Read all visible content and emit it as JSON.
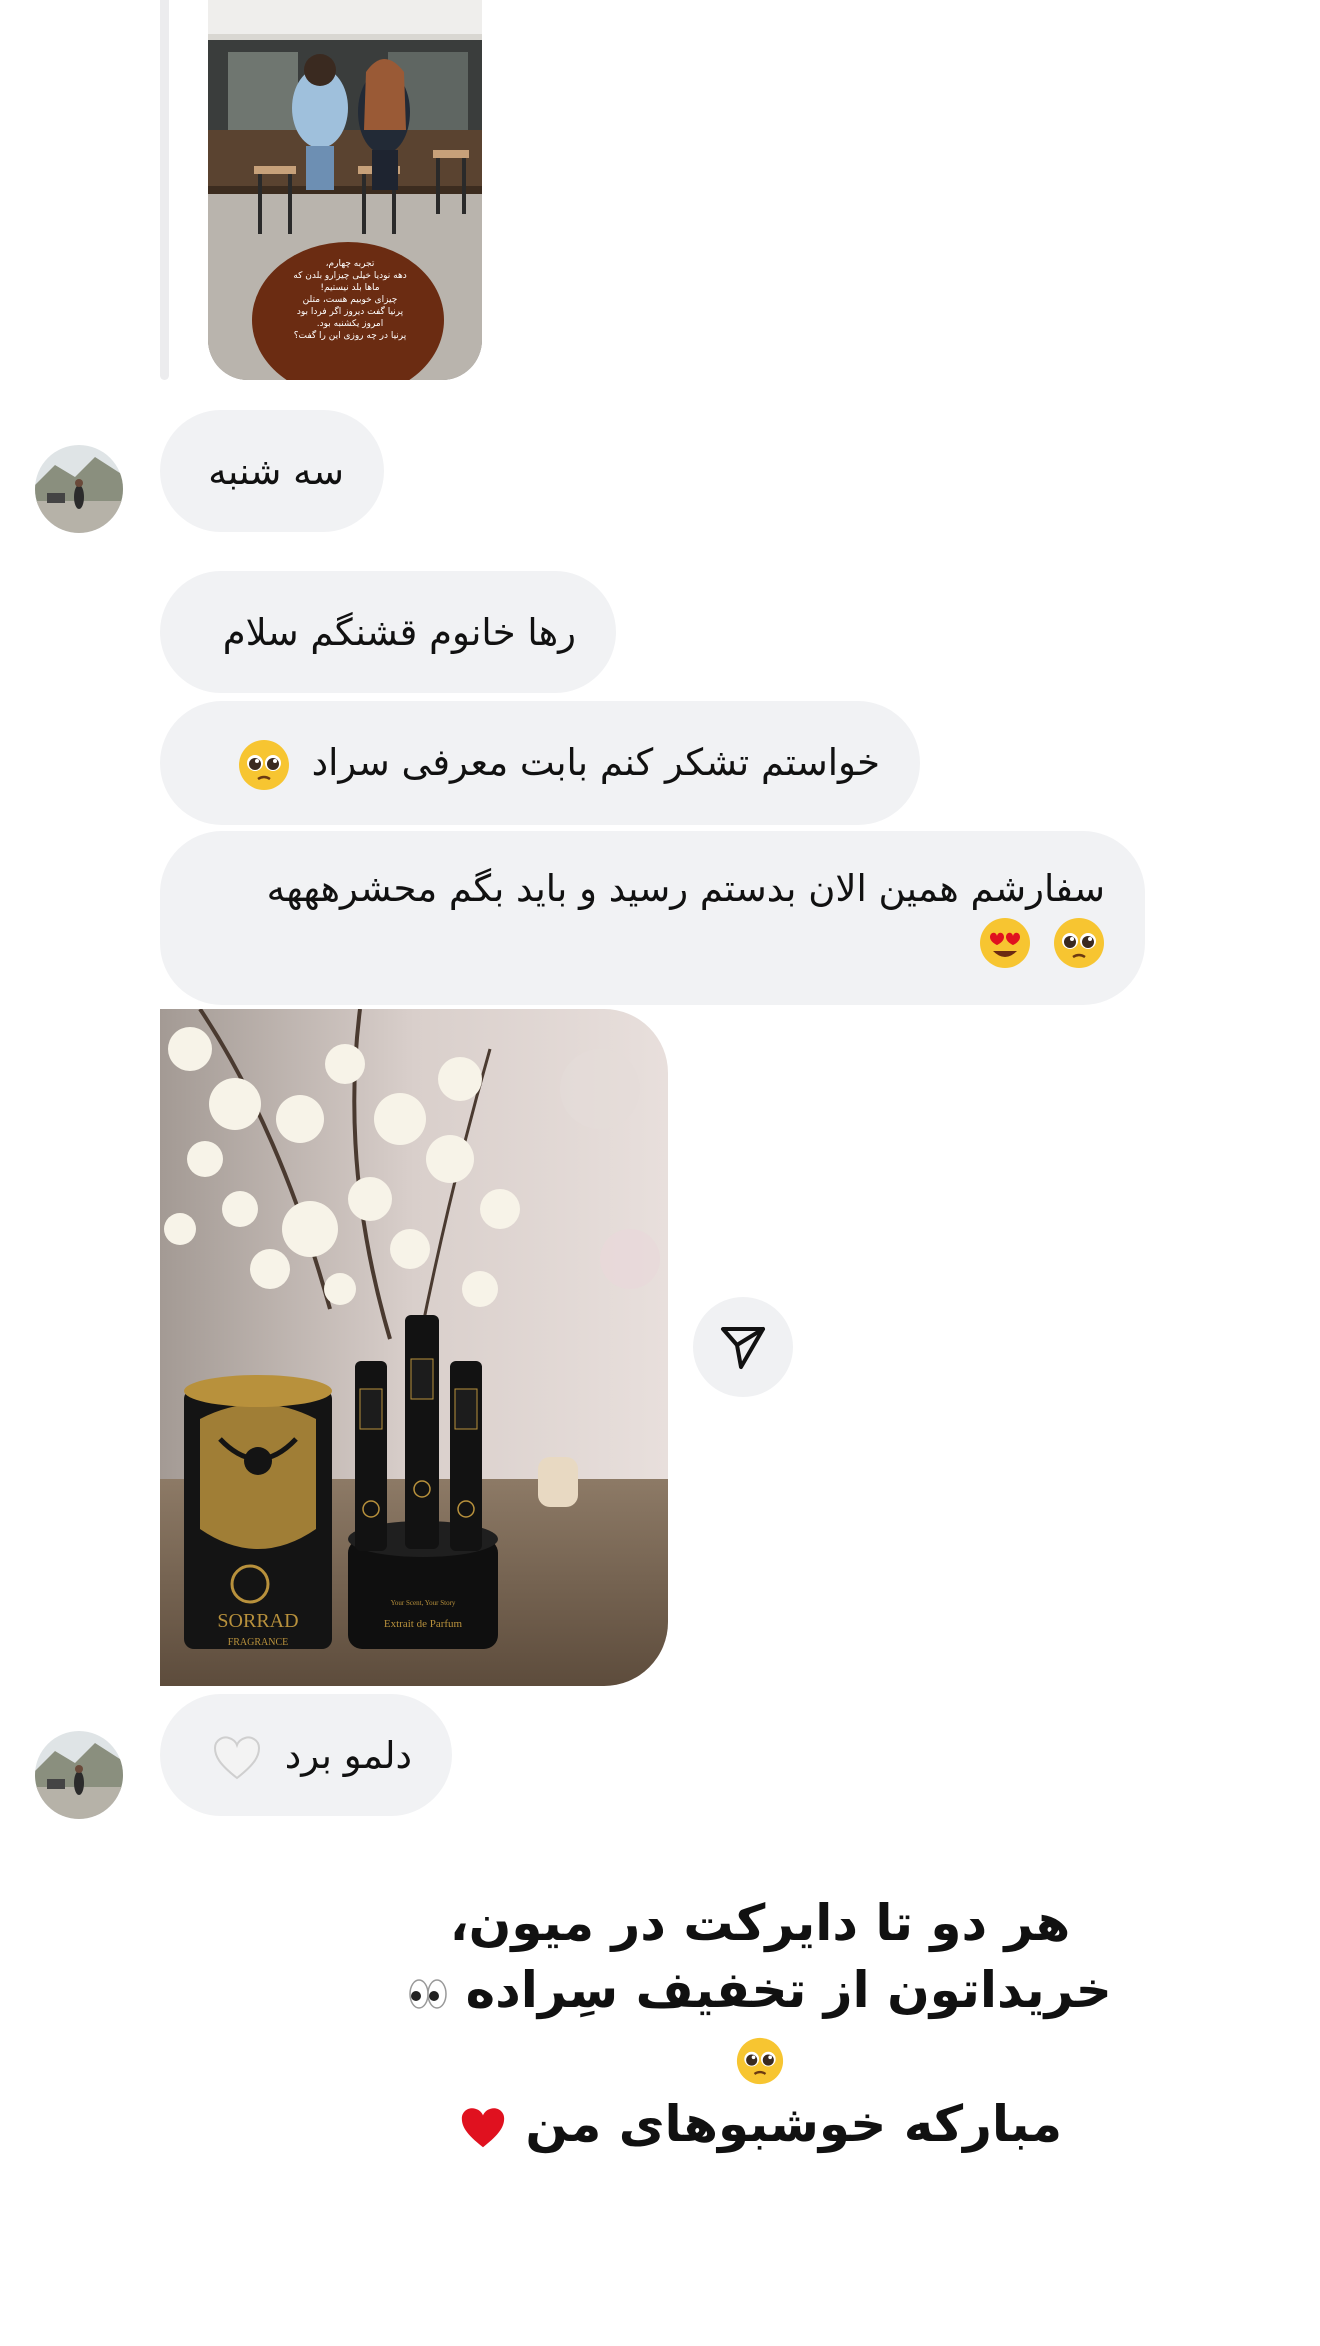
{
  "story": {
    "overlay_text": [
      "تجربه چهارم،",
      "دهه نودیا خیلی چیزارو بلدن که",
      "ماها بلد نیستیم!",
      "چیزای خوبیم هست، متلن",
      "پرنیا گفت دیروز اگر فردا بود",
      "امروز یکشنبه بود.",
      "پرنیا در چه روزی این را گفت؟"
    ]
  },
  "messages": [
    {
      "text": "سه شنبه",
      "emoji": ""
    },
    {
      "text": "رها خانوم قشنگم سلام",
      "emoji": ""
    },
    {
      "text": "خواستم تشکر کنم بابت معرفی سراد",
      "emoji": "pleading-face"
    },
    {
      "text": "سفارشم همین الان بدستم رسید و باید بگم محشرهههه",
      "emoji": "pleading-face heart-eyes-face"
    },
    {
      "text": "دلمو برد",
      "emoji": "white-heart"
    }
  ],
  "product_photo": {
    "brand_text": "SORRAD",
    "brand_sub": "FRAGRANCE",
    "jar_text": "Extrait de Parfum",
    "jar_small": "Your Scent, Your Story"
  },
  "caption": {
    "line1": "هر دو تا دایرکت در میون،",
    "line2": "خریداتون از تخفیف سِراده",
    "line3": "مبارکه خوشبوهای من"
  },
  "colors": {
    "bubble_bg": "#f1f2f4",
    "heart_red": "#e0111f",
    "jar_black": "#141414",
    "jar_gold": "#b8913c"
  }
}
